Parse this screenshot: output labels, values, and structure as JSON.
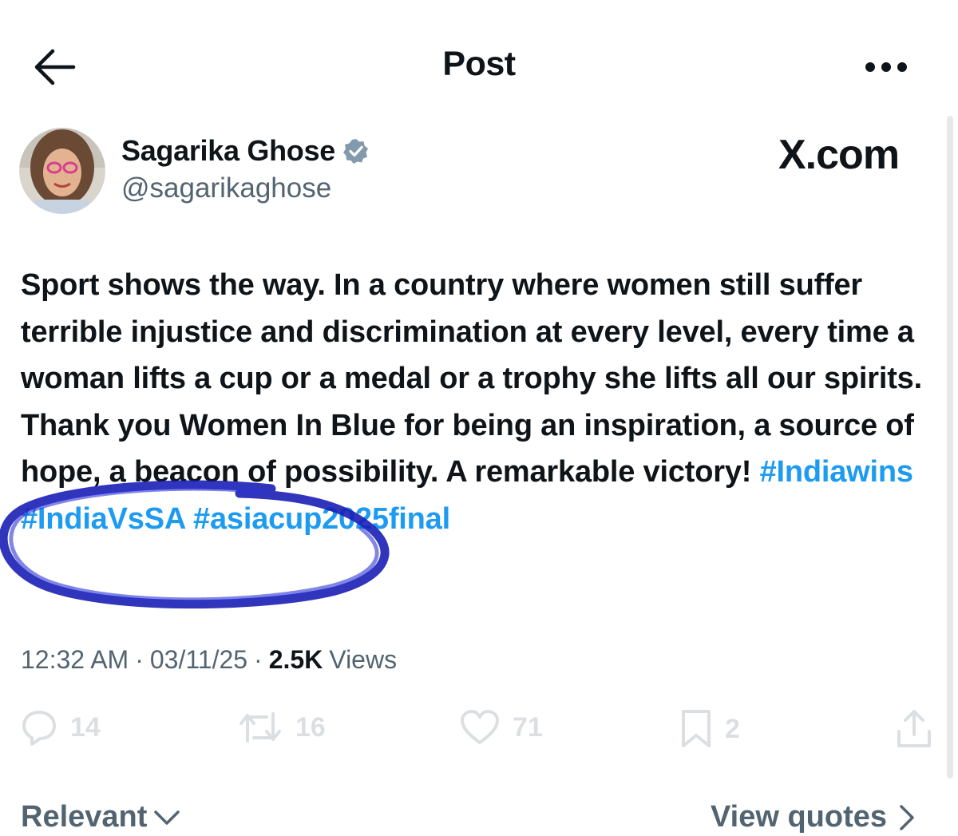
{
  "header": {
    "title": "Post"
  },
  "author": {
    "name": "Sagarika Ghose",
    "handle": "@sagarikaghose",
    "verified": true
  },
  "watermark": "X.com",
  "post": {
    "text": "Sport shows the way. In a country where women still suffer terrible injustice and discrimination at every level, every time a woman lifts a cup or a medal or a trophy she lifts all our spirits. Thank you Women In Blue for being an inspiration, a source of hope, a beacon of possibility. A remarkable victory! ",
    "hashtags": [
      "#Indiawins",
      "#IndiaVsSA",
      "#asiacup2025final"
    ]
  },
  "meta": {
    "time": "12:32 AM",
    "date": "03/11/25",
    "views_count": "2.5K",
    "views_label": "Views"
  },
  "stats": {
    "replies": "14",
    "reposts": "16",
    "likes": "71",
    "bookmarks": "2"
  },
  "footer": {
    "sort_label": "Relevant",
    "quotes_label": "View quotes"
  },
  "colors": {
    "link": "#1d9bf0",
    "secondary": "#536471",
    "verified": "#829aab",
    "scribble": "#1a1fb5"
  }
}
